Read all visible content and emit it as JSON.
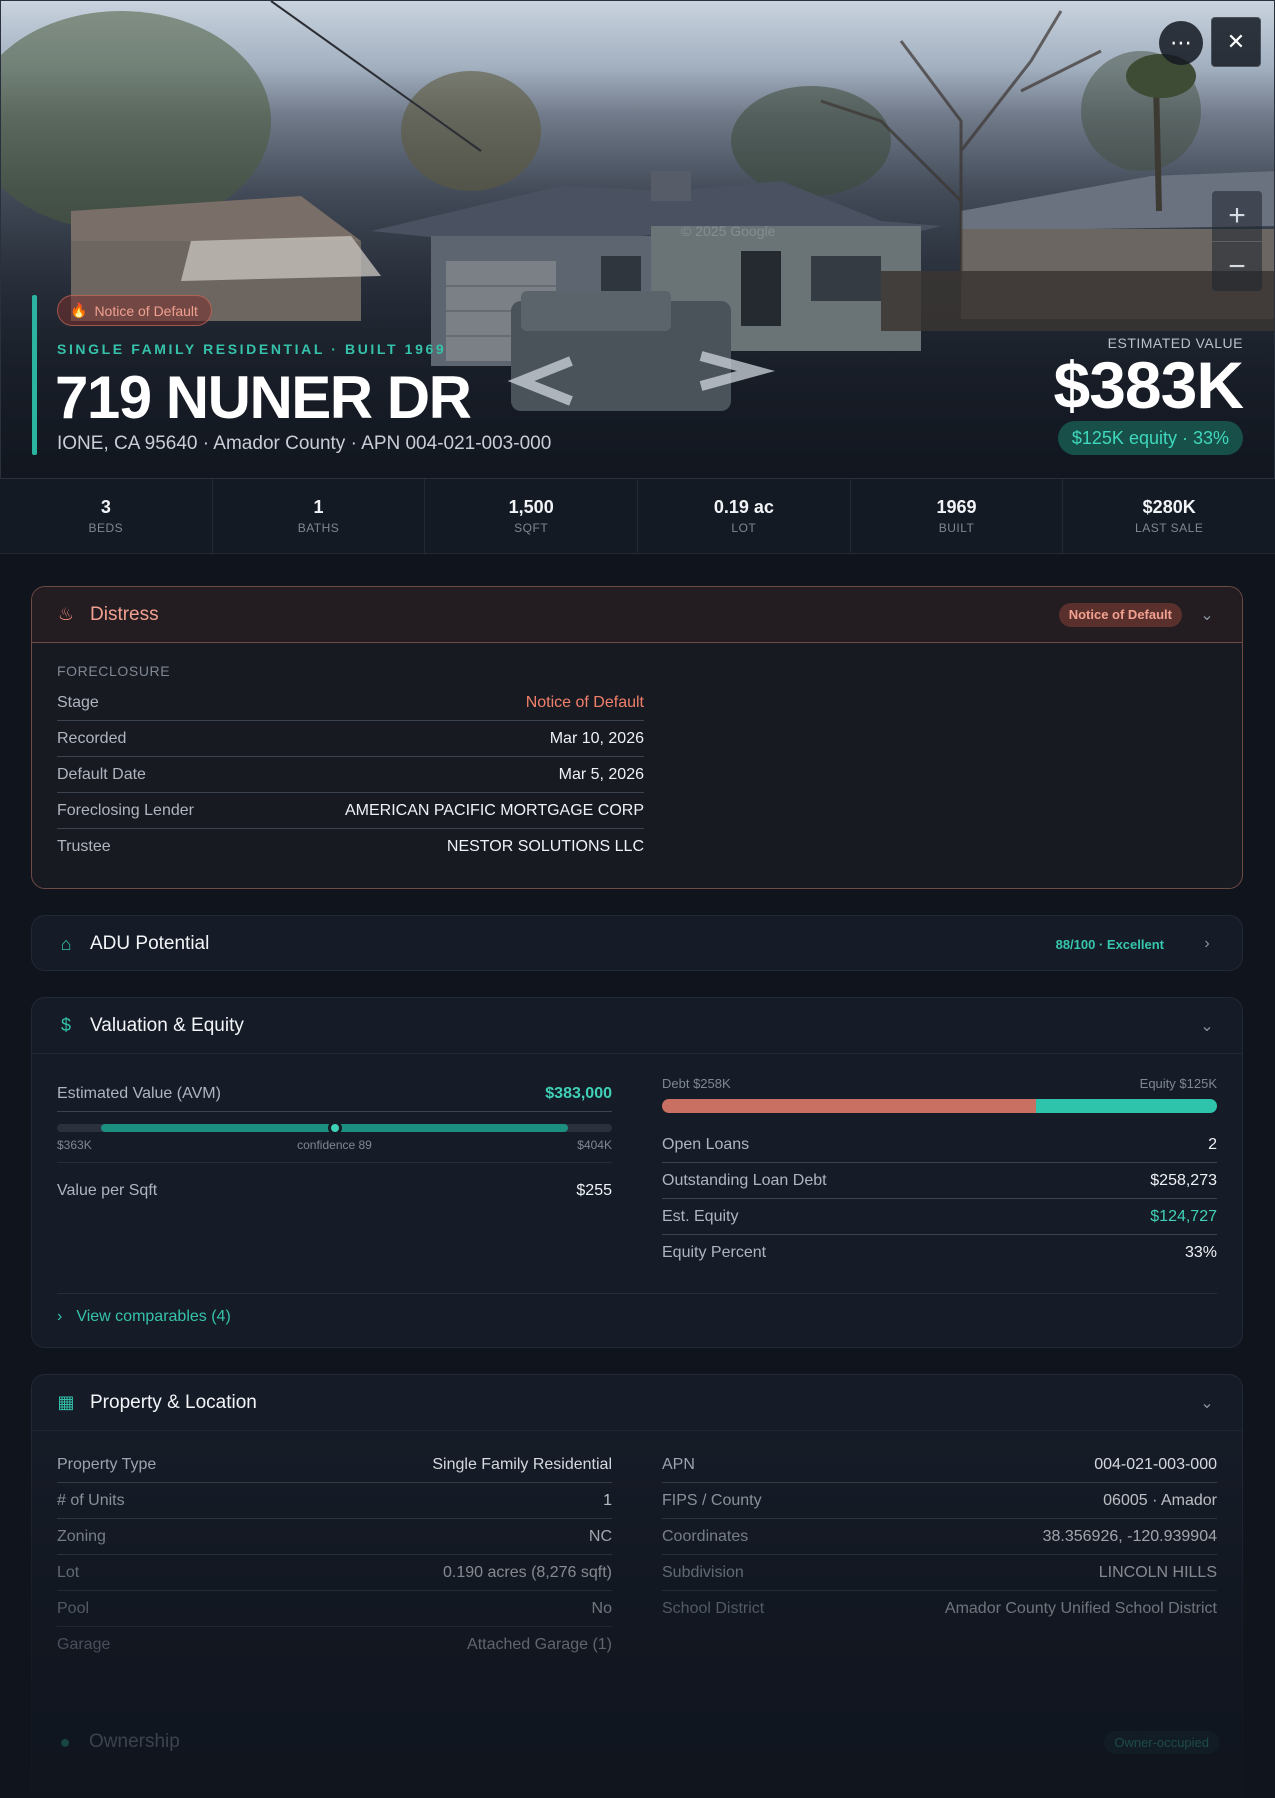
{
  "hero": {
    "badge_label": "Notice of Default",
    "subline": "SINGLE FAMILY RESIDENTIAL · BUILT 1969",
    "address": "719 NUNER DR",
    "location_line": "IONE, CA 95640 · Amador County · APN 004-021-003-000",
    "est_label": "ESTIMATED VALUE",
    "est_value": "$383K",
    "equity_pill": "$125K equity · 33%",
    "watermark": "© 2025 Google",
    "more_icon": "ellipsis-icon",
    "close_icon": "close-icon",
    "zoom_in": "+",
    "zoom_out": "−"
  },
  "stats": [
    {
      "value": "3",
      "label": "BEDS"
    },
    {
      "value": "1",
      "label": "BATHS"
    },
    {
      "value": "1,500",
      "label": "SQFT"
    },
    {
      "value": "0.19 ac",
      "label": "LOT"
    },
    {
      "value": "1969",
      "label": "BUILT"
    },
    {
      "value": "$280K",
      "label": "LAST SALE"
    }
  ],
  "distress": {
    "title": "Distress",
    "tag": "Notice of Default",
    "caption": "FORECLOSURE",
    "rows": [
      {
        "k": "Stage",
        "v": "Notice of Default"
      },
      {
        "k": "Recorded",
        "v": "Mar 10, 2026"
      },
      {
        "k": "Default Date",
        "v": "Mar 5, 2026"
      },
      {
        "k": "Foreclosing Lender",
        "v": "AMERICAN PACIFIC MORTGAGE CORP"
      },
      {
        "k": "Trustee",
        "v": "NESTOR SOLUTIONS LLC"
      }
    ]
  },
  "adu": {
    "title": "ADU Potential",
    "score": "88/100 · Excellent"
  },
  "valuation": {
    "title": "Valuation & Equity",
    "avm_label": "Estimated Value (AVM)",
    "avm_value": "$383,000",
    "avm_low": "$363K",
    "avm_confidence": "confidence 89",
    "avm_high": "$404K",
    "avm_position_pct": 50,
    "value_per_sqft_label": "Value per Sqft",
    "value_per_sqft": "$255",
    "debt_label": "Debt $258K",
    "equity_label": "Equity $125K",
    "debt_fraction": 0.674,
    "debt_color": "#c97063",
    "equity_color": "#2ec4ac",
    "rows": [
      {
        "k": "Open Loans",
        "v": "2"
      },
      {
        "k": "Outstanding Loan Debt",
        "v": "$258,273"
      },
      {
        "k": "Est. Equity",
        "v": "$124,727"
      },
      {
        "k": "Equity Percent",
        "v": "33%"
      }
    ],
    "comparables": "View comparables (4)"
  },
  "property": {
    "title": "Property & Location",
    "left": [
      {
        "k": "Property Type",
        "v": "Single Family Residential"
      },
      {
        "k": "# of Units",
        "v": "1"
      },
      {
        "k": "Zoning",
        "v": "NC"
      },
      {
        "k": "Lot",
        "v": "0.190 acres (8,276 sqft)"
      },
      {
        "k": "Pool",
        "v": "No"
      },
      {
        "k": "Garage",
        "v": "Attached Garage (1)"
      }
    ],
    "right": [
      {
        "k": "APN",
        "v": "004-021-003-000"
      },
      {
        "k": "FIPS / County",
        "v": "06005 · Amador"
      },
      {
        "k": "Coordinates",
        "v": "38.356926, -120.939904"
      },
      {
        "k": "Subdivision",
        "v": "LINCOLN HILLS"
      },
      {
        "k": "School District",
        "v": "Amador County Unified School District"
      }
    ]
  },
  "ownership": {
    "title": "Ownership",
    "tag": "Owner-occupied"
  }
}
